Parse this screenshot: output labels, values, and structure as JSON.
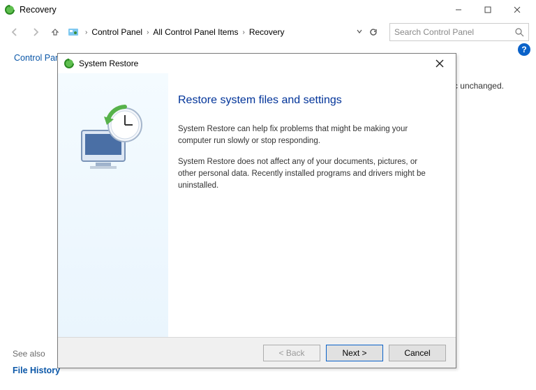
{
  "window": {
    "title": "Recovery",
    "minimize": "—",
    "maximize": "☐",
    "close": "✕"
  },
  "nav": {
    "crumb_cp": "Control Panel",
    "crumb_all": "All Control Panel Items",
    "crumb_rec": "Recovery",
    "search_placeholder": "Search Control Panel"
  },
  "page": {
    "cpl_home": "Control Panel Home",
    "see_also": "See also",
    "file_history": "File History",
    "bg_phrase_tail": "ic unchanged.",
    "help": "?"
  },
  "dialog": {
    "title": "System Restore",
    "close": "✕",
    "heading": "Restore system files and settings",
    "para1": "System Restore can help fix problems that might be making your computer run slowly or stop responding.",
    "para2": "System Restore does not affect any of your documents, pictures, or other personal data. Recently installed programs and drivers might be uninstalled.",
    "back": "< Back",
    "next": "Next >",
    "cancel": "Cancel"
  }
}
